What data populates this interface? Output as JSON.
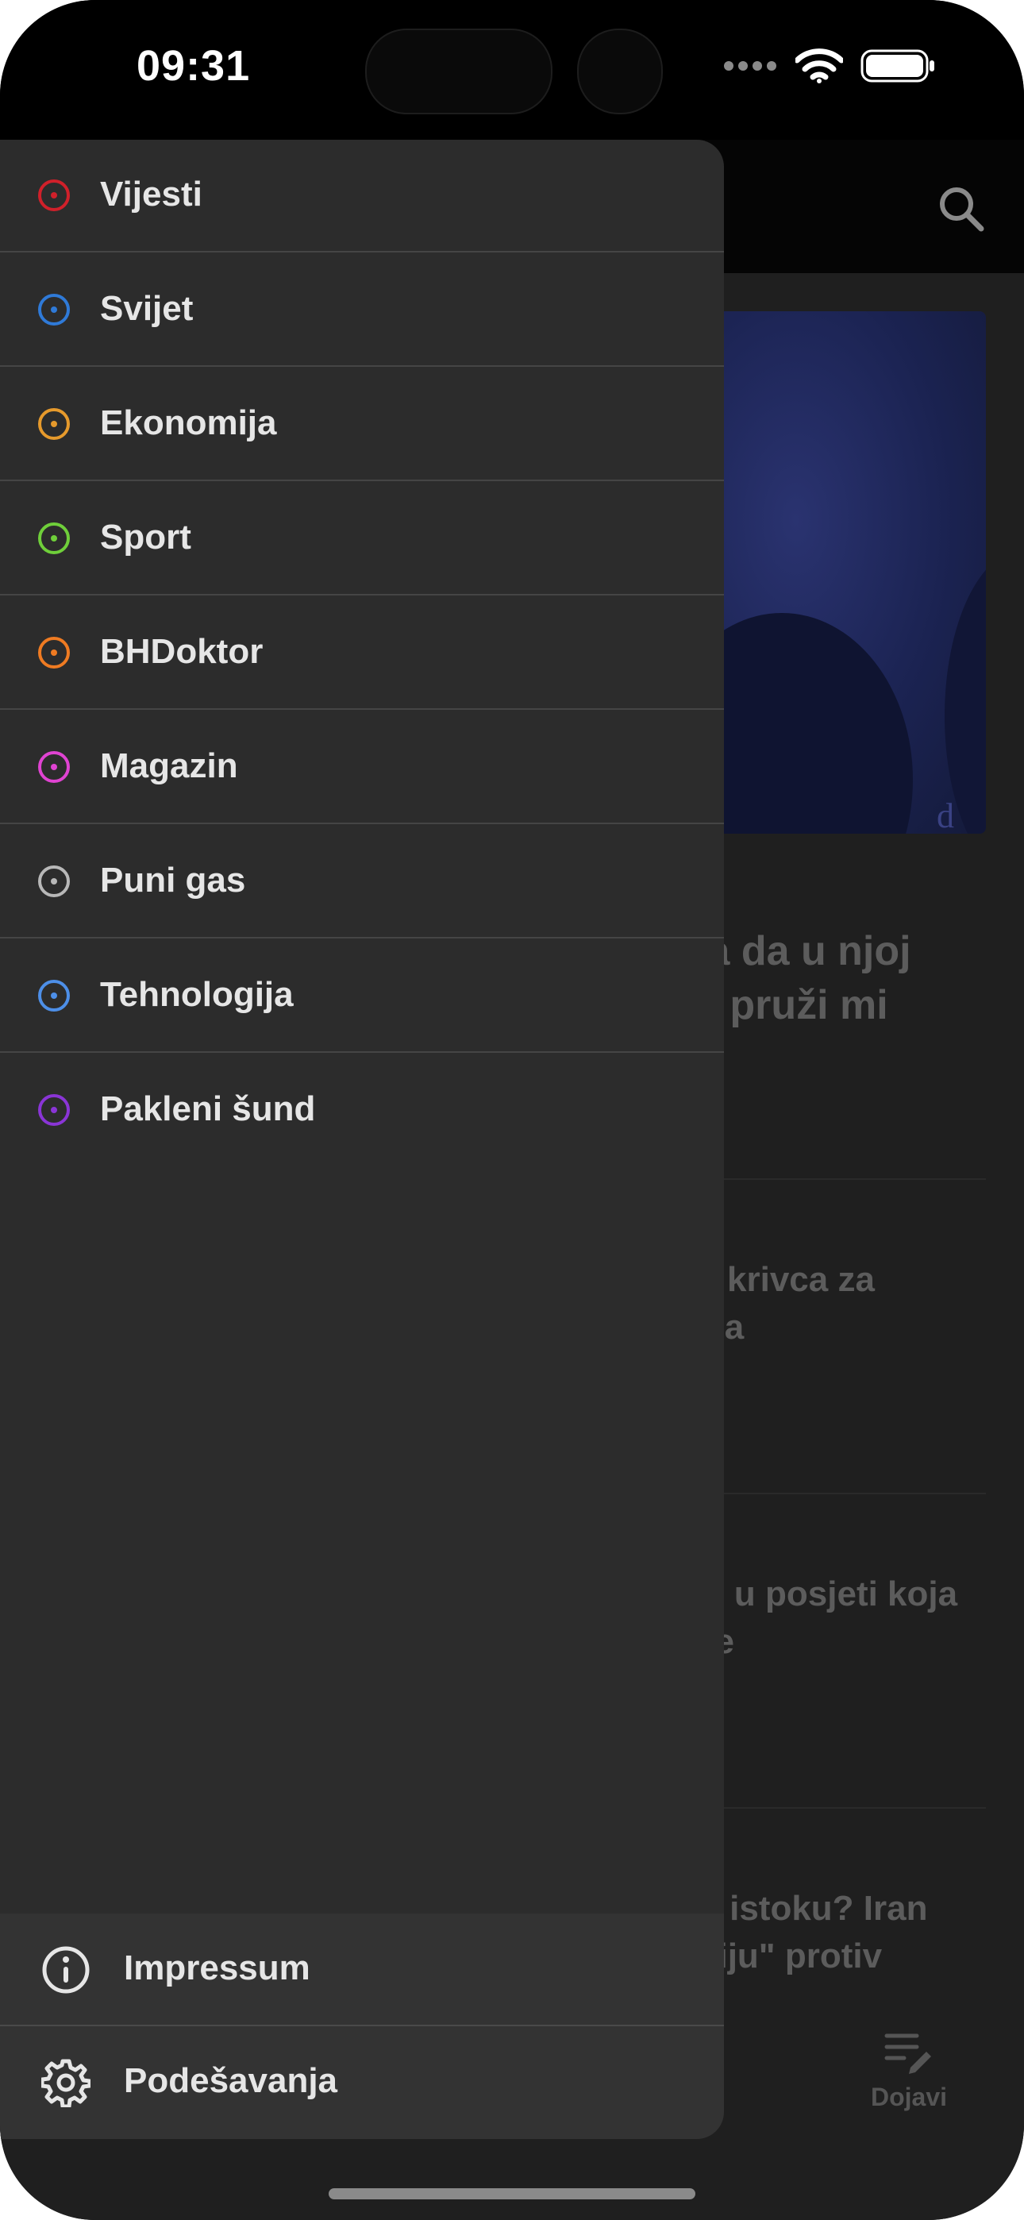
{
  "status_bar": {
    "time": "09:31"
  },
  "background": {
    "headline_1_line1": "ja da u njoj",
    "headline_1_line2": "e pruži mi",
    "headline_2_line1": "krivca za",
    "headline_2_line2": "ala",
    "headline_3_line1": "el u posjeti koja",
    "headline_3_line2": "ke",
    "headline_4_line1": "n istoku? Iran",
    "headline_4_line2": "ciju\" protiv",
    "hero_watermark": "d He",
    "tab_label": "Dojavi"
  },
  "menu": {
    "items": [
      {
        "label": "Vijesti",
        "color": "#d0202a"
      },
      {
        "label": "Svijet",
        "color": "#2f7ad8"
      },
      {
        "label": "Ekonomija",
        "color": "#e69a2c"
      },
      {
        "label": "Sport",
        "color": "#6fcf3a"
      },
      {
        "label": "BHDoktor",
        "color": "#ef7b22"
      },
      {
        "label": "Magazin",
        "color": "#e043d2"
      },
      {
        "label": "Puni gas",
        "color": "#b8b8b8"
      },
      {
        "label": "Tehnologija",
        "color": "#4d8fe8"
      },
      {
        "label": "Pakleni šund",
        "color": "#8a35d6"
      }
    ],
    "footer": [
      {
        "label": "Impressum",
        "icon": "info-icon"
      },
      {
        "label": "Podešavanja",
        "icon": "gear-icon"
      }
    ]
  }
}
